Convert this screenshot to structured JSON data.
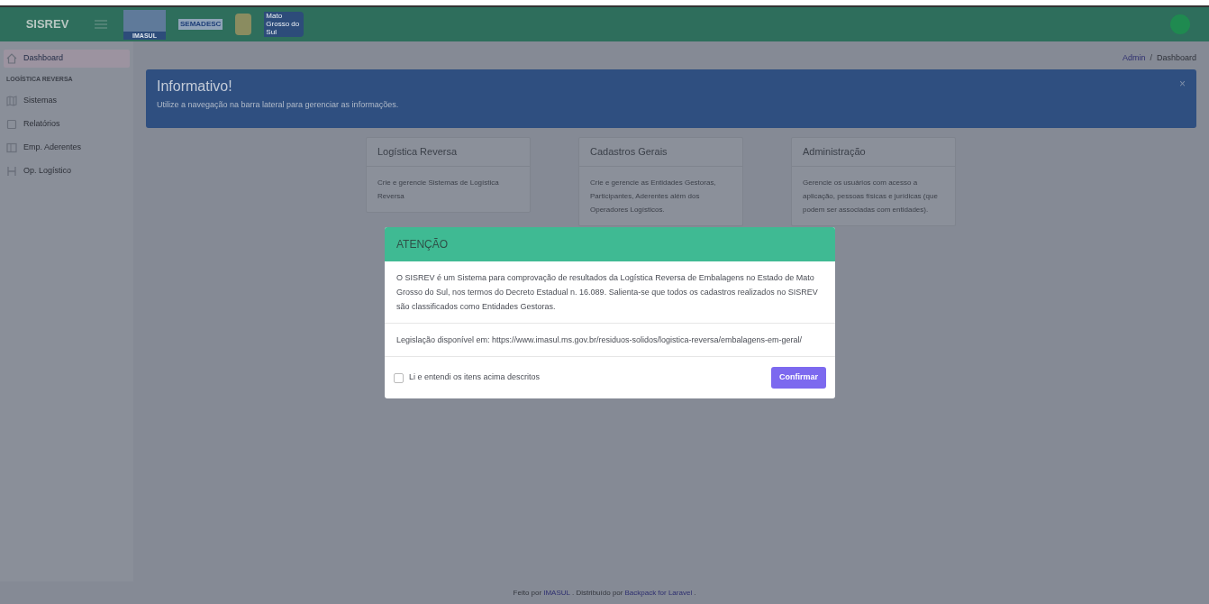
{
  "header": {
    "brand": "SISREV",
    "logo_texts": [
      "IMASUL",
      "SEMADESC",
      "Mato Grosso do Sul"
    ]
  },
  "sidebar": {
    "items": [
      {
        "kind": "link",
        "label": "Dashboard",
        "selected": true
      },
      {
        "kind": "heading",
        "label": "LOGÍSTICA REVERSA"
      },
      {
        "kind": "link",
        "label": "Sistemas",
        "selected": false
      },
      {
        "kind": "link",
        "label": "Relatórios",
        "selected": false
      },
      {
        "kind": "link",
        "label": "Emp. Aderentes",
        "selected": false
      },
      {
        "kind": "link",
        "label": "Op. Logístico",
        "selected": false
      }
    ]
  },
  "breadcrumb": {
    "items": [
      "Admin",
      "Dashboard"
    ],
    "separator": "/"
  },
  "alert": {
    "title": "Informativo!",
    "text": "Utilize a navegação na barra lateral para gerenciar as informações.",
    "close": "×"
  },
  "cards": [
    {
      "title": "Logística Reversa",
      "text": "Crie e gerencie Sistemas de Logística Reversa"
    },
    {
      "title": "Cadastros Gerais",
      "text": "Crie e gerencie as Entidades Gestoras, Participantes, Aderentes além dos Operadores Logísticos."
    },
    {
      "title": "Administração",
      "text": "Gerencie os usuários com acesso a aplicação, pessoas físicas e jurídicas (que podem ser associadas com entidades)."
    }
  ],
  "modal": {
    "title": "ATENÇÃO",
    "body": "O SISREV é um Sistema para comprovação de resultados da Logística Reversa de Embalagens no Estado de Mato Grosso do Sul, nos termos do Decreto Estadual n. 16.089. Salienta-se que todos os cadastros realizados no SISREV são classificados como Entidades Gestoras.",
    "legislation": "Legislação disponível em: https://www.imasul.ms.gov.br/residuos-solidos/logistica-reversa/embalagens-em-geral/",
    "checkbox": {
      "label": "Li e entendi os itens acima descritos",
      "checked": false
    },
    "button": "Confirmar"
  },
  "footer": {
    "prefix": "Feito por",
    "author": "IMASUL",
    "middle": ". Distribuído por",
    "framework": "Backpack for Laravel",
    "suffix": "."
  }
}
